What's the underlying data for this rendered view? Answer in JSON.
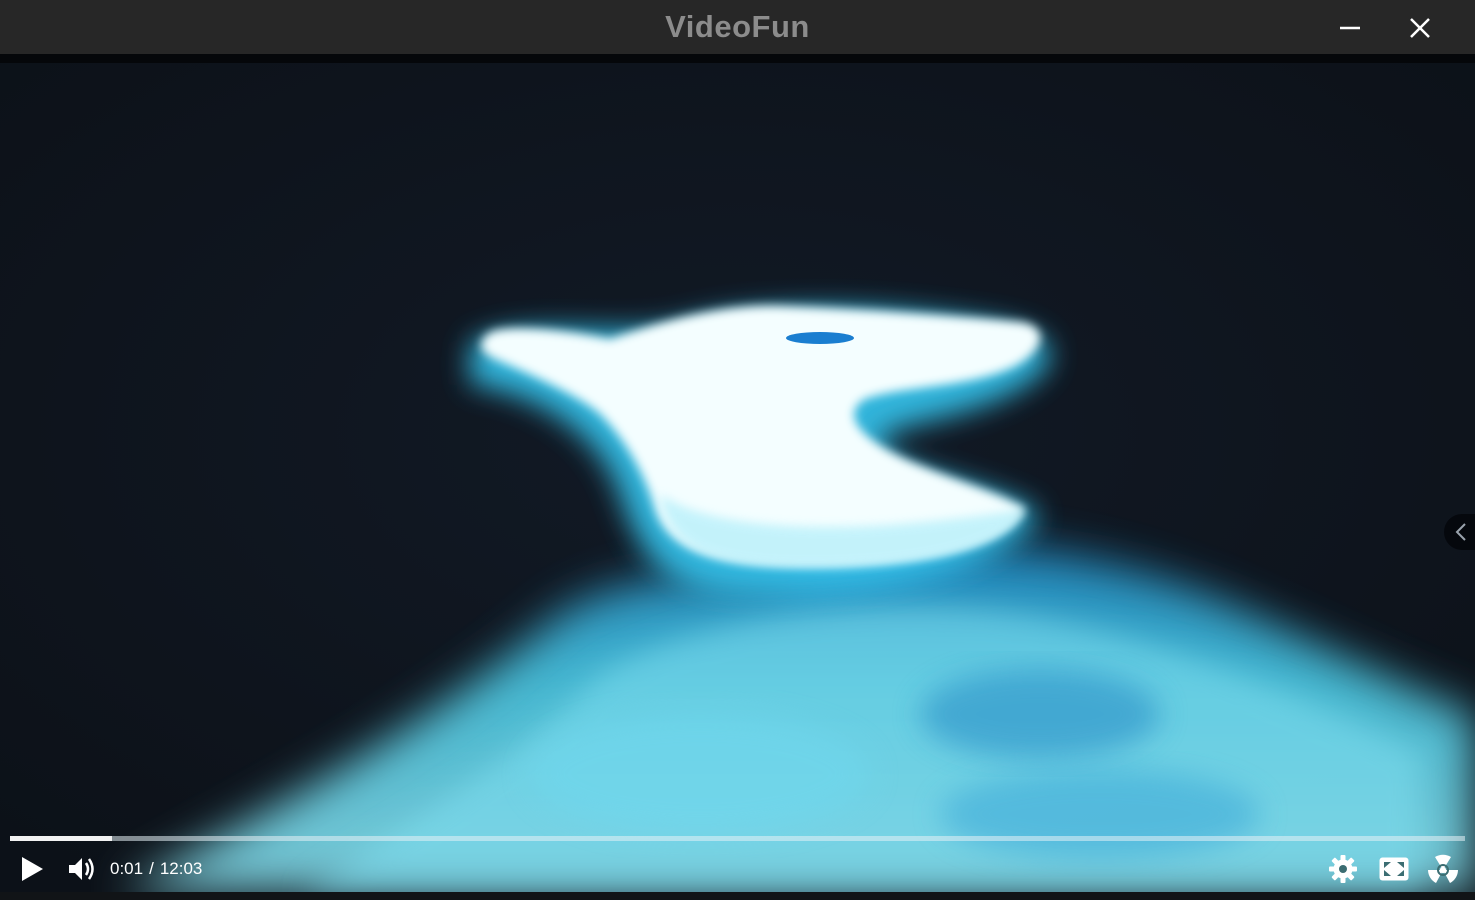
{
  "window": {
    "title": "VideoFun",
    "minimize_icon": "minimize-icon",
    "close_icon": "close-icon"
  },
  "player": {
    "current_time": "0:01",
    "separator": "/",
    "duration": "12:03",
    "progress_fraction": 0.07,
    "controls": {
      "play_icon": "play-icon",
      "volume_icon": "volume-icon",
      "settings_icon": "gear-icon",
      "fit_icon": "fit-screen-icon",
      "extra_icon": "radiation-icon",
      "side_toggle_icon": "chevron-left-icon"
    }
  },
  "colors": {
    "titlebar": "#272727",
    "title_text": "#8c8c8c",
    "video_bg": "#0f141d",
    "glow": "#2ec8f0"
  }
}
